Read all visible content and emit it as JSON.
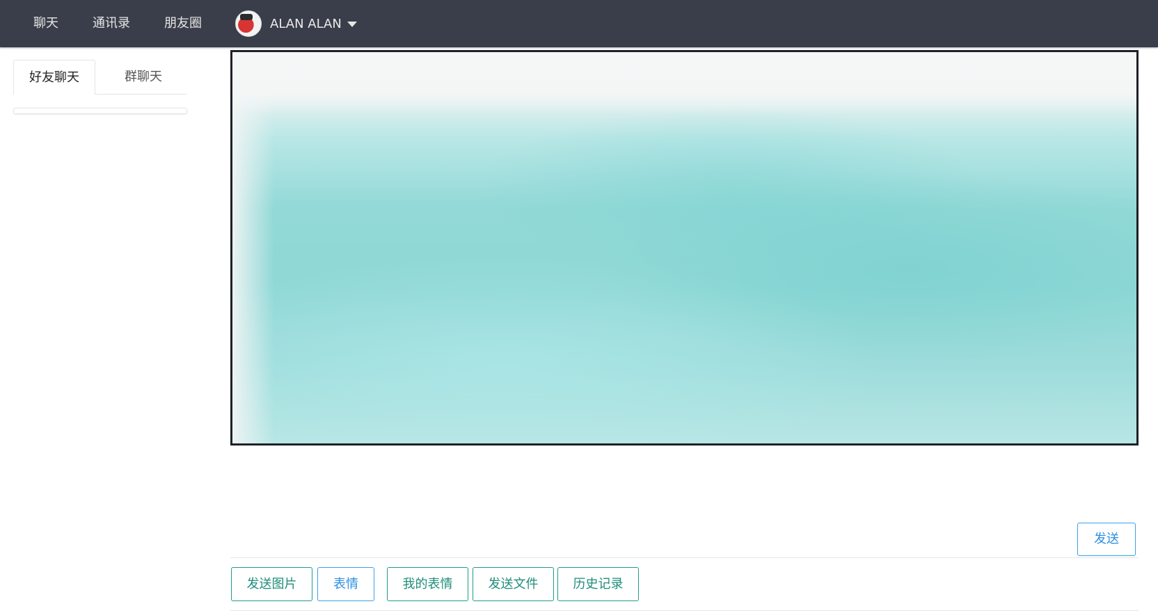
{
  "navbar": {
    "items": [
      {
        "label": "聊天"
      },
      {
        "label": "通讯录"
      },
      {
        "label": "朋友圈"
      }
    ],
    "user": {
      "name": "ALAN ALAN",
      "avatar_icon": "user-avatar"
    }
  },
  "left_panel": {
    "tabs": [
      {
        "label": "好友聊天",
        "active": true
      },
      {
        "label": "群聊天",
        "active": false
      }
    ]
  },
  "composer": {
    "send_label": "发送"
  },
  "toolbar": {
    "buttons": [
      {
        "label": "发送图片"
      },
      {
        "label": "表情"
      },
      {
        "label": "我的表情"
      },
      {
        "label": "发送文件"
      },
      {
        "label": "历史记录"
      }
    ]
  },
  "colors": {
    "navbar_bg": "#3a3e4a",
    "accent_blue": "#2d8fe0",
    "accent_teal": "#1f8d79"
  }
}
